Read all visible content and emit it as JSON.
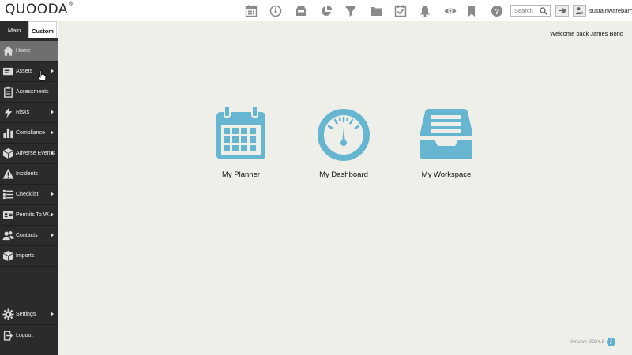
{
  "app": {
    "logo": "QUOODA",
    "logo_mark": "®"
  },
  "toolbar": {
    "icons": [
      "calendar-icon",
      "gauge-icon",
      "inbox-icon",
      "pie-chart-icon",
      "filter-icon",
      "folder-icon",
      "checklist-icon",
      "bell-icon",
      "eye-icon",
      "bookmark-icon",
      "help-icon"
    ],
    "search_placeholder": "Search",
    "username": "sustainwarebarry"
  },
  "sidebar": {
    "tabs": [
      {
        "label": "Main",
        "active": true
      },
      {
        "label": "Custom",
        "active": false
      }
    ],
    "items": [
      {
        "label": "Home",
        "icon": "home-icon",
        "has_submenu": false,
        "active": true
      },
      {
        "label": "Assets",
        "icon": "asset-icon",
        "has_submenu": true,
        "active": false
      },
      {
        "label": "Assessments",
        "icon": "clipboard-icon",
        "has_submenu": false,
        "active": false
      },
      {
        "label": "Risks",
        "icon": "lightning-icon",
        "has_submenu": true,
        "active": false
      },
      {
        "label": "Compliance",
        "icon": "bar-chart-icon",
        "has_submenu": true,
        "active": false
      },
      {
        "label": "Adverse Events",
        "icon": "cube-icon",
        "has_submenu": true,
        "active": false
      },
      {
        "label": "Incidents",
        "icon": "warning-icon",
        "has_submenu": false,
        "active": false
      },
      {
        "label": "Checklist",
        "icon": "list-icon",
        "has_submenu": true,
        "active": false
      },
      {
        "label": "Permits To W...",
        "icon": "permit-icon",
        "has_submenu": true,
        "active": false
      },
      {
        "label": "Contacts",
        "icon": "contacts-icon",
        "has_submenu": true,
        "active": false
      },
      {
        "label": "Imports",
        "icon": "import-box-icon",
        "has_submenu": false,
        "active": false
      }
    ],
    "bottom_items": [
      {
        "label": "Settings",
        "icon": "gear-icon",
        "has_submenu": true
      },
      {
        "label": "Logout",
        "icon": "logout-icon",
        "has_submenu": false
      }
    ]
  },
  "main": {
    "welcome": "Welcome back James Bond",
    "tiles": [
      {
        "label": "My Planner",
        "icon": "planner-calendar-icon"
      },
      {
        "label": "My Dashboard",
        "icon": "dashboard-gauge-icon"
      },
      {
        "label": "My Workspace",
        "icon": "workspace-tray-icon"
      }
    ],
    "version": "Version: 2024.5"
  },
  "colors": {
    "accent": "#66b5d1",
    "sidebar_bg": "#2b2b2b",
    "sidebar_active": "#6f6f6f",
    "content_bg": "#efefea"
  }
}
